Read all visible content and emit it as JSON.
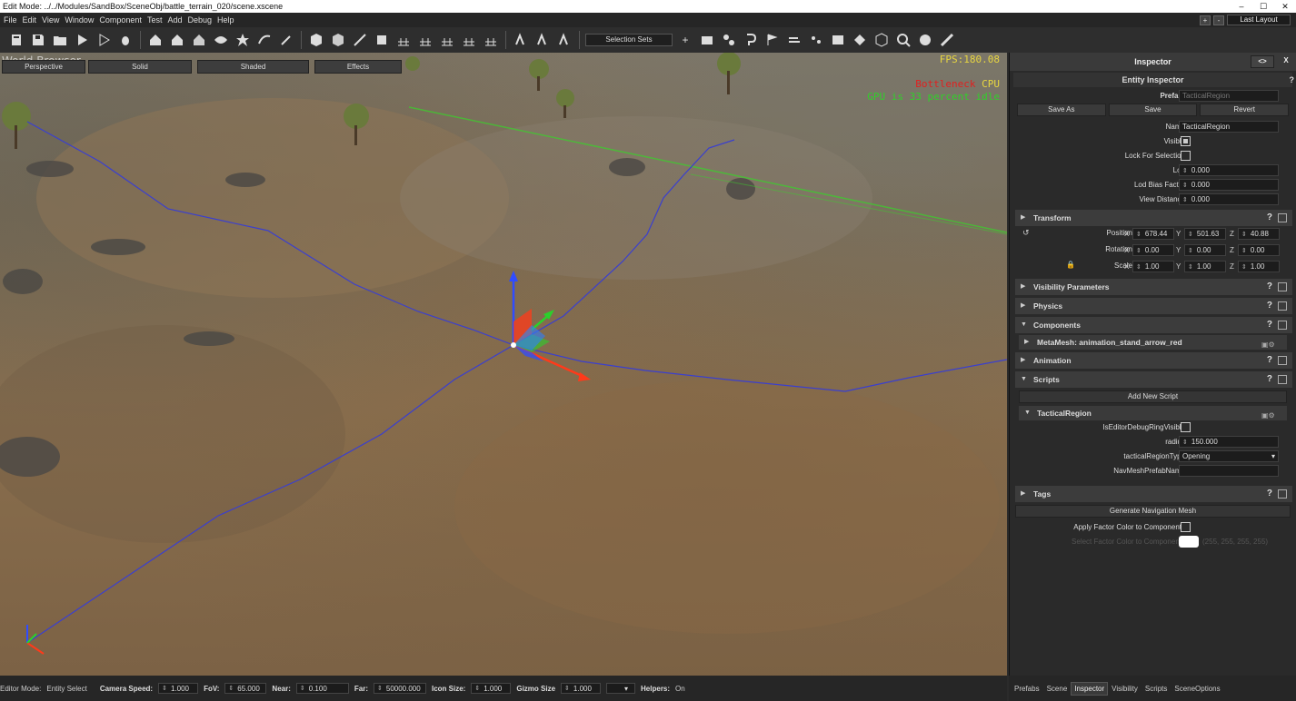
{
  "window": {
    "title": "Edit Mode: ../../Modules/SandBox/SceneObj/battle_terrain_020/scene.xscene",
    "min": "–",
    "max": "☐",
    "close": "✕"
  },
  "menu": {
    "items": [
      "File",
      "Edit",
      "View",
      "Window",
      "Component",
      "Test",
      "Add",
      "Debug",
      "Help"
    ],
    "plus": "+",
    "minus": "-",
    "layout_button": "Last Layout"
  },
  "toolbar": {
    "selection_sets": "Selection Sets",
    "add": "+"
  },
  "viewport": {
    "scene_name": "World Browser",
    "buttons": [
      "Perspective",
      "Solid",
      "Shaded",
      "Effects"
    ],
    "fps": "FPS:180.08",
    "bottleneck_label": "Bottleneck",
    "bottleneck_value": "CPU",
    "gpu_idle": "GPU is 33 percent idle"
  },
  "statusbar": {
    "editor_mode_label": "Editor Mode:",
    "editor_mode_value": "Entity Select",
    "camera_speed_label": "Camera Speed:",
    "camera_speed_value": "1.000",
    "fov_label": "FoV:",
    "fov_value": "65.000",
    "near_label": "Near:",
    "near_value": "0.100",
    "far_label": "Far:",
    "far_value": "50000.000",
    "icon_size_label": "Icon Size:",
    "icon_size_value": "1.000",
    "gizmo_size_label": "Gizmo Size",
    "gizmo_size_value": "1.000",
    "helpers_label": "Helpers:",
    "helpers_value": "On"
  },
  "inspector": {
    "title": "Inspector",
    "collapse_btn": "<>",
    "close_btn": "X",
    "entity_title": "Entity Inspector",
    "help": "?",
    "prefab_label": "Prefab:",
    "prefab_value": "TacticalRegion",
    "save_as": "Save As",
    "save": "Save",
    "revert": "Revert",
    "name_label": "Name",
    "name_value": "TacticalRegion",
    "visible_label": "Visible",
    "lock_label": "Lock For Selection",
    "lod_label": "Lod",
    "lod_value": "0.000",
    "lod_bias_label": "Lod Bias Factor",
    "lod_bias_value": "0.000",
    "view_dist_label": "View Distance",
    "view_dist_value": "0.000",
    "transform": {
      "title": "Transform",
      "reset_icon": "↺",
      "lock_icon": "🔒",
      "position_label": "Position",
      "rotation_label": "Rotation",
      "scale_label": "Scale",
      "x": "X",
      "y": "Y",
      "z": "Z",
      "position": [
        "678.44",
        "501.63",
        "40.88"
      ],
      "rotation": [
        "0.00",
        "0.00",
        "0.00"
      ],
      "scale": [
        "1.00",
        "1.00",
        "1.00"
      ]
    },
    "sections": {
      "visibility": "Visibility Parameters",
      "physics": "Physics",
      "components": "Components",
      "metamesh": "MetaMesh: animation_stand_arrow_red",
      "animation": "Animation",
      "scripts": "Scripts",
      "add_script": "Add New Script",
      "tactical_region": "TacticalRegion",
      "tags": "Tags"
    },
    "script_fields": {
      "debug_ring_label": "IsEditorDebugRingVisible",
      "radius_label": "radius",
      "radius_value": "150.000",
      "region_type_label": "tacticalRegionType",
      "region_type_value": "Opening",
      "navmesh_label": "NavMeshPrefabName",
      "navmesh_value": ""
    },
    "generate_navmesh": "Generate Navigation Mesh",
    "apply_factor_label": "Apply Factor Color to Components",
    "select_factor_label": "Select Factor Color to Components",
    "factor_color_value": "(255, 255, 255, 255)",
    "factor_color": "#ffffff"
  },
  "bottom_tabs": [
    "Prefabs",
    "Scene",
    "Inspector",
    "Visibility",
    "Scripts",
    "SceneOptions"
  ],
  "active_tab": "Inspector"
}
